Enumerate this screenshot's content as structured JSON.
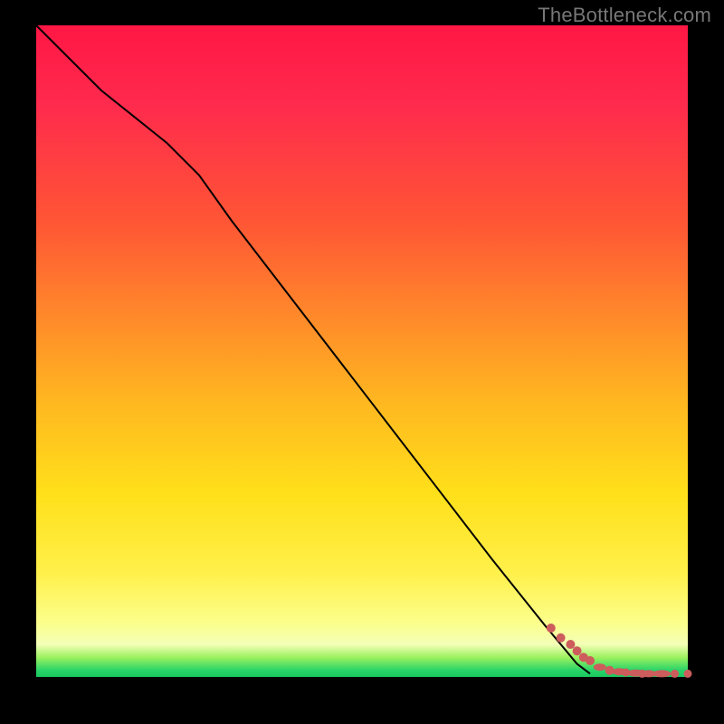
{
  "watermark": "TheBottleneck.com",
  "chart_data": {
    "type": "line",
    "title": "",
    "xlabel": "",
    "ylabel": "",
    "xlim": [
      0,
      100
    ],
    "ylim": [
      0,
      100
    ],
    "grid": false,
    "legend": false,
    "background_gradient": {
      "direction": "vertical_top_to_bottom",
      "stops": [
        {
          "pct": 0,
          "color": "#ff1744"
        },
        {
          "pct": 30,
          "color": "#ff5535"
        },
        {
          "pct": 58,
          "color": "#ffb820"
        },
        {
          "pct": 84,
          "color": "#fff04a"
        },
        {
          "pct": 95,
          "color": "#f4ffb8"
        },
        {
          "pct": 99,
          "color": "#27d469"
        },
        {
          "pct": 100,
          "color": "#19c75e"
        }
      ],
      "semantic": "top = bottleneck/bad (red), bottom = no bottleneck/good (green)"
    },
    "series": [
      {
        "name": "curve",
        "kind": "line",
        "color": "#000000",
        "x": [
          0,
          10,
          20,
          25,
          30,
          40,
          50,
          60,
          70,
          78,
          83,
          85
        ],
        "y": [
          100,
          90,
          82,
          77,
          70,
          57,
          44,
          31,
          18,
          8,
          2,
          0.5
        ]
      },
      {
        "name": "optimal-points",
        "kind": "scatter",
        "color": "#cd5c5c",
        "note": "points & short dashes along the flat green floor",
        "x": [
          79,
          80.5,
          82,
          83,
          84,
          85,
          86.5,
          88,
          89.5,
          90.5,
          92,
          93,
          94,
          96,
          98,
          100
        ],
        "y": [
          7.5,
          6,
          5,
          4,
          3,
          2.5,
          1.5,
          1,
          0.8,
          0.7,
          0.6,
          0.5,
          0.5,
          0.5,
          0.5,
          0.5
        ]
      }
    ]
  }
}
